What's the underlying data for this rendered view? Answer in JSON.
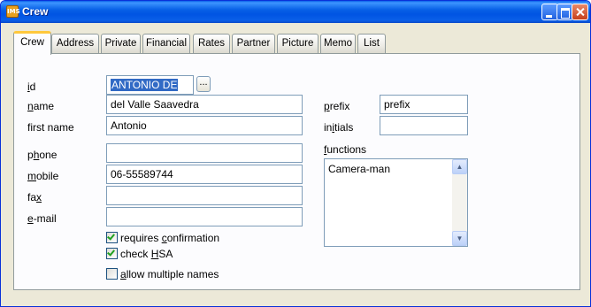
{
  "window": {
    "title": "Crew",
    "app_icon_text": "IMS"
  },
  "tabs": [
    {
      "label": "Crew",
      "active": true
    },
    {
      "label": "Address"
    },
    {
      "label": "Private"
    },
    {
      "label": "Financial"
    },
    {
      "label": "Rates"
    },
    {
      "label": "Partner"
    },
    {
      "label": "Picture"
    },
    {
      "label": "Memo"
    },
    {
      "label": "List"
    }
  ],
  "form": {
    "id": {
      "label_u": "i",
      "label_rest": "d",
      "value": "ANTONIO DE",
      "lookup_label": "..."
    },
    "name": {
      "label_u": "n",
      "label_rest": "ame",
      "value": "del Valle Saavedra"
    },
    "first_name": {
      "label": "first name",
      "value": "Antonio"
    },
    "phone": {
      "label_pre": "p",
      "label_u": "h",
      "label_rest": "one",
      "value": ""
    },
    "mobile": {
      "label_u": "m",
      "label_rest": "obile",
      "value": "06-55589744"
    },
    "fax": {
      "label_pre": "fa",
      "label_u": "x",
      "label_rest": "",
      "value": ""
    },
    "email": {
      "label_u": "e",
      "label_rest": "-mail",
      "value": ""
    },
    "prefix": {
      "label_u": "p",
      "label_rest": "refix",
      "value": "prefix"
    },
    "initials": {
      "label_pre": "in",
      "label_u": "i",
      "label_rest": "tials",
      "value": ""
    },
    "functions": {
      "label_u": "f",
      "label_rest": "unctions",
      "items": [
        "Camera-man"
      ]
    },
    "requires_confirmation": {
      "label_pre": "requires ",
      "label_u": "c",
      "label_rest": "onfirmation",
      "checked": true
    },
    "check_hsa": {
      "label_pre": "check ",
      "label_u": "H",
      "label_rest": "SA",
      "checked": true
    },
    "allow_multiple_names": {
      "label_u": "a",
      "label_rest": "llow multiple names",
      "checked": false
    }
  },
  "colors": {
    "title_bar": "#0054e3",
    "active_tab_accent": "#ffc83c",
    "selection": "#316ac5",
    "check_mark": "#21a121"
  }
}
